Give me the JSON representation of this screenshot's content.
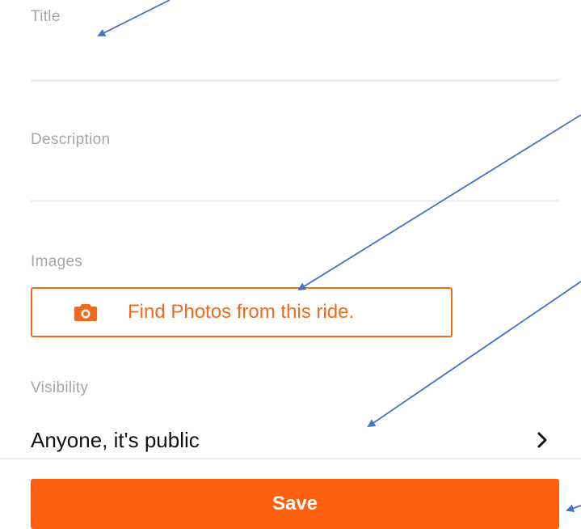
{
  "form": {
    "title_label": "Title",
    "title_value": "",
    "description_label": "Description",
    "description_value": "",
    "images_label": "Images",
    "find_photos_label": "Find Photos from this ride.",
    "visibility_label": "Visibility",
    "visibility_value": "Anyone, it's public"
  },
  "actions": {
    "save_label": "Save"
  },
  "icons": {
    "photos": "camera-icon",
    "visibility": "chevron-right-icon"
  },
  "colors": {
    "accent": "#fc6010",
    "accent_outline": "#f26a1b",
    "label": "#a6a6a6",
    "annotation_arrow": "#4472c4"
  }
}
